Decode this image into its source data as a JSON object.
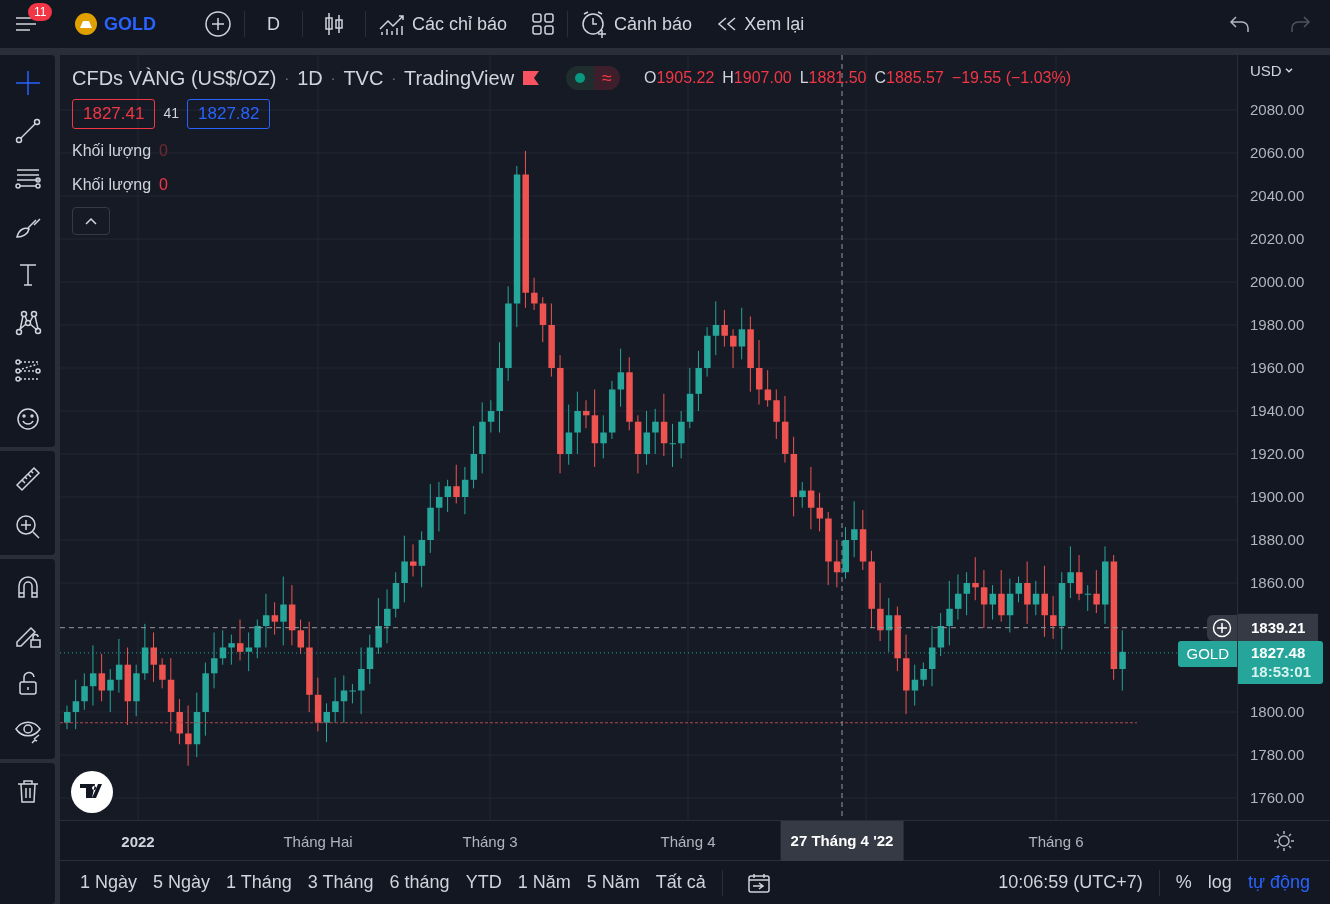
{
  "top_bar": {
    "menu_badge": "11",
    "symbol": "GOLD",
    "interval": "D",
    "indicators": "Các chỉ báo",
    "alerts": "Cảnh báo",
    "replay": "Xem lại"
  },
  "tool_groups": [
    [
      {
        "kind": "crosshair",
        "selected": true
      },
      {
        "kind": "line",
        "selected": false
      },
      {
        "kind": "hlines",
        "selected": false
      },
      {
        "kind": "brush",
        "selected": false
      },
      {
        "kind": "text",
        "selected": false
      },
      {
        "kind": "pattern",
        "selected": false
      },
      {
        "kind": "forecast",
        "selected": false
      },
      {
        "kind": "emoji",
        "selected": false
      }
    ],
    [
      {
        "kind": "ruler",
        "selected": false
      },
      {
        "kind": "zoom",
        "selected": false
      }
    ],
    [
      {
        "kind": "magnet",
        "selected": false
      },
      {
        "kind": "lockdraw",
        "selected": false
      },
      {
        "kind": "lock",
        "selected": false
      },
      {
        "kind": "eye",
        "selected": false
      }
    ],
    [
      {
        "kind": "trash",
        "selected": false
      }
    ]
  ],
  "legend": {
    "title_parts": [
      {
        "text": "CFDs VÀNG (US$/OZ)",
        "kind": "title"
      },
      {
        "text": "·",
        "kind": "separator"
      },
      {
        "text": "1D",
        "kind": "interval"
      },
      {
        "text": "·",
        "kind": "separator"
      },
      {
        "text": "TVC",
        "kind": "exchange"
      },
      {
        "text": "·",
        "kind": "separator"
      },
      {
        "text": "TradingView",
        "kind": "source"
      }
    ],
    "status_glyph": "≈",
    "ohlc": [
      {
        "label": "O",
        "value": "1905.22"
      },
      {
        "label": "H",
        "value": "1907.00"
      },
      {
        "label": "L",
        "value": "1881.50"
      },
      {
        "label": "C",
        "value": "1885.57"
      }
    ],
    "change": "−19.55 (−1.03%)",
    "sell": "1827.41",
    "spread": "41",
    "buy": "1827.82",
    "studies": [
      {
        "label": "Khối lượng",
        "value": "0",
        "dimmed": true
      },
      {
        "label": "Khối lượng",
        "value": "0",
        "dimmed": false
      }
    ]
  },
  "price_axis": {
    "currency": "USD",
    "ticks": [
      "2080.00",
      "2060.00",
      "2040.00",
      "2020.00",
      "2000.00",
      "1980.00",
      "1960.00",
      "1940.00",
      "1920.00",
      "1900.00",
      "1880.00",
      "1860.00",
      "1800.00",
      "1780.00",
      "1760.00"
    ],
    "crosshair_price": "1839.21",
    "last_price": {
      "symbol": "GOLD",
      "price": "1827.48",
      "countdown": "18:53:01"
    }
  },
  "time_axis": {
    "labels": [
      {
        "text": "2022",
        "kind": "year"
      },
      {
        "text": "Tháng Hai",
        "kind": "month"
      },
      {
        "text": "Tháng 3",
        "kind": "month"
      },
      {
        "text": "Tháng 4",
        "kind": "month"
      },
      {
        "text": "Tháng 6",
        "kind": "month"
      }
    ],
    "crosshair_date": "27 Tháng 4 '22"
  },
  "bottom_bar": {
    "ranges": [
      "1 Ngày",
      "5 Ngày",
      "1 Tháng",
      "3 Tháng",
      "6 tháng",
      "YTD",
      "1 Năm",
      "5 Năm",
      "Tất cả"
    ],
    "clock": "10:06:59 (UTC+7)",
    "percent": "%",
    "log": "log",
    "auto": {
      "label": "tự động",
      "on": true
    }
  }
}
